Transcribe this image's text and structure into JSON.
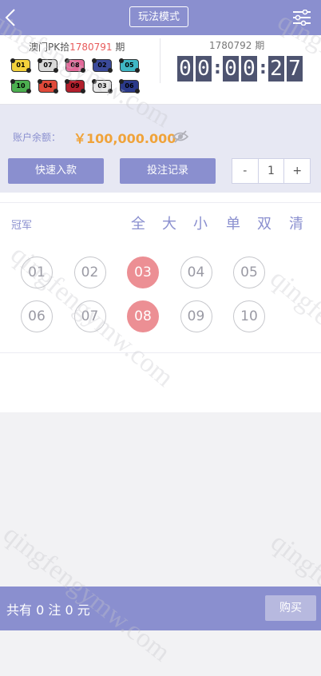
{
  "header": {
    "mode_button": "玩法模式",
    "icons": {
      "back": "chevron-left-icon",
      "settings": "sliders-icon"
    }
  },
  "last_draw": {
    "title_prefix": "澳门PK拾",
    "issue": "1780791",
    "title_suffix": " 期",
    "results": [
      {
        "num": "01",
        "color": "#f4d23c"
      },
      {
        "num": "07",
        "color": "#d9d9d9"
      },
      {
        "num": "08",
        "color": "#e36a9a"
      },
      {
        "num": "02",
        "color": "#3b4a9a"
      },
      {
        "num": "05",
        "color": "#3fb7c4"
      },
      {
        "num": "10",
        "color": "#4caf50"
      },
      {
        "num": "04",
        "color": "#e04a3a"
      },
      {
        "num": "09",
        "color": "#b21f2c"
      },
      {
        "num": "03",
        "color": "#e8e8e8"
      },
      {
        "num": "06",
        "color": "#2b3a8a"
      }
    ]
  },
  "next_draw": {
    "title": "1780792 期",
    "timer": [
      "0",
      "0",
      ":",
      "0",
      "0",
      ":",
      "2",
      "7"
    ]
  },
  "account": {
    "balance_label": "账户余额：",
    "balance_value": "￥100,000.000",
    "deposit_button": "快速入款",
    "records_button": "投注记录",
    "stepper": {
      "minus": "-",
      "value": "1",
      "plus": "+"
    }
  },
  "play": {
    "category": "冠军",
    "filters": [
      "全",
      "大",
      "小",
      "单",
      "双",
      "清"
    ],
    "numbers": [
      {
        "label": "01",
        "selected": false
      },
      {
        "label": "02",
        "selected": false
      },
      {
        "label": "03",
        "selected": true
      },
      {
        "label": "04",
        "selected": false
      },
      {
        "label": "05",
        "selected": false
      },
      {
        "label": "06",
        "selected": false
      },
      {
        "label": "07",
        "selected": false
      },
      {
        "label": "08",
        "selected": true
      },
      {
        "label": "09",
        "selected": false
      },
      {
        "label": "10",
        "selected": false
      }
    ]
  },
  "footer": {
    "summary": "共有 0 注  0 元",
    "buy_button": "购买"
  },
  "watermark": "qingfengymw.com",
  "colors": {
    "accent": "#8a8fcf",
    "selected_ball": "#ec8f94",
    "balance": "#f0a33a",
    "timer_bg": "#4e5470"
  }
}
